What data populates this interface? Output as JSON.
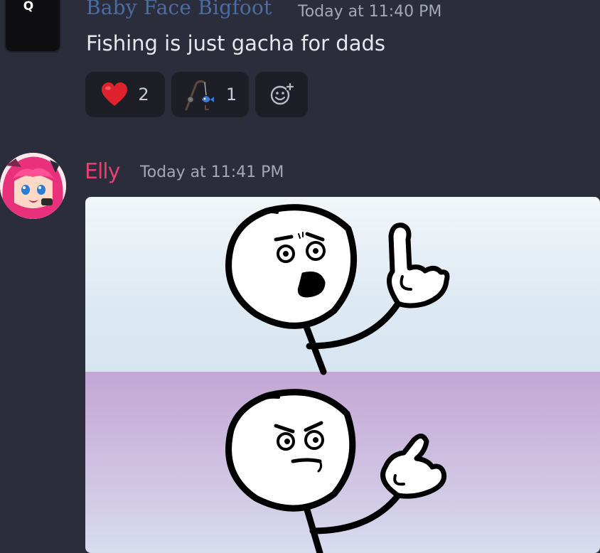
{
  "messages": [
    {
      "author": "Baby Face Bigfoot",
      "timestamp": "Today at 11:40 PM",
      "content": "Fishing is just gacha for dads",
      "avatar": {
        "keycap_letter": "Q",
        "icon": "keycap-q-avatar"
      },
      "reactions": [
        {
          "emoji": "red-heart-icon",
          "count": "2"
        },
        {
          "emoji": "fishing-rod-icon",
          "count": "1"
        }
      ],
      "add_reaction_icon": "add-reaction-icon"
    },
    {
      "author": "Elly",
      "timestamp": "Today at 11:41 PM",
      "avatar": {
        "icon": "anime-girl-avatar"
      },
      "attachment": {
        "icon": "meme-image"
      }
    }
  ],
  "colors": {
    "background": "#2b2d3b",
    "author1": "#4a6da3",
    "author2": "#e5406f",
    "timestamp": "#a4a8b4",
    "message_text": "#e6e8ee",
    "reaction_bg": "#1e1f26"
  }
}
